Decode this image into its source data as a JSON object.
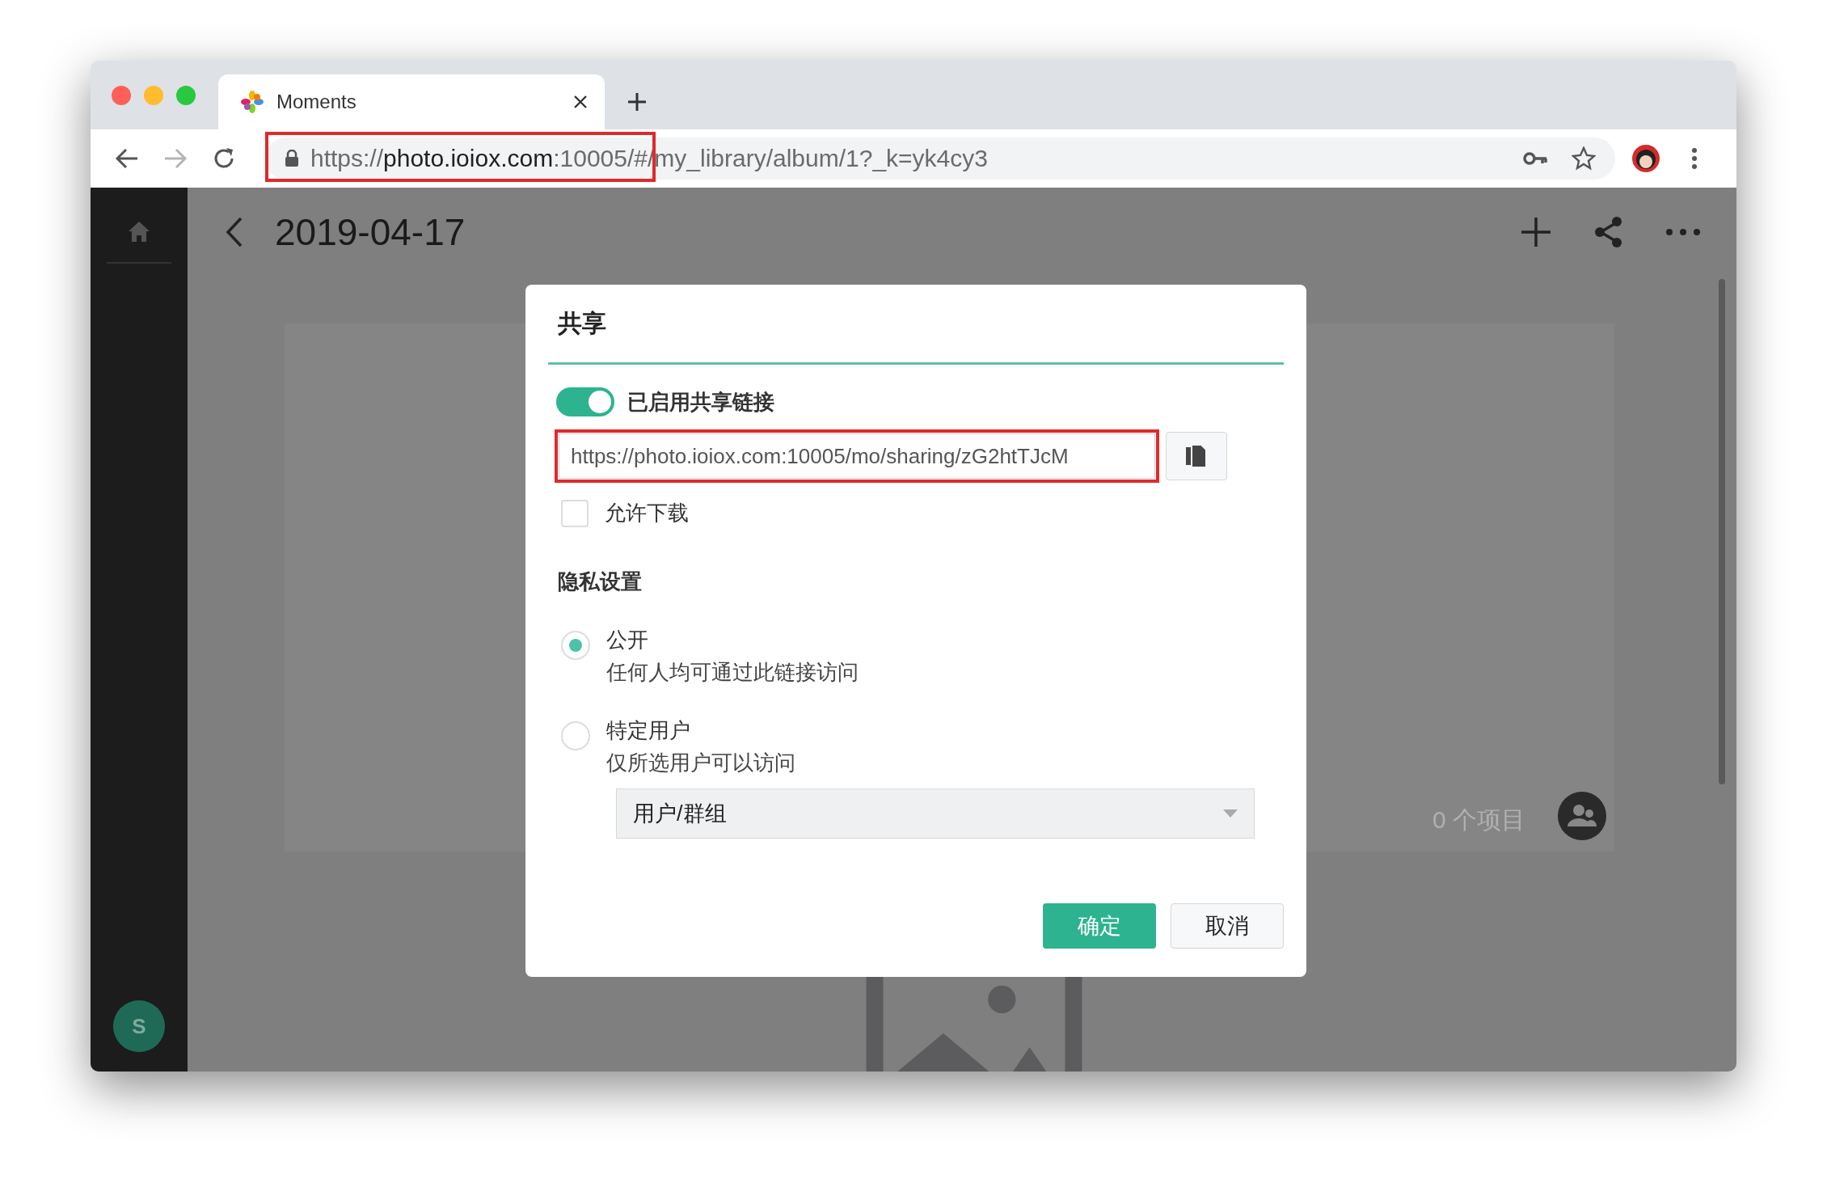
{
  "browser": {
    "tab": {
      "title": "Moments"
    },
    "url": {
      "scheme": "https://",
      "host": "photo.ioiox.com",
      "port": ":10005/",
      "rest": "#/my_library/album/1?_k=yk4cy3"
    }
  },
  "page": {
    "title": "2019-04-17",
    "item_count": "0 个项目",
    "avatar_initial": "S"
  },
  "dialog": {
    "title": "共享",
    "share_link": {
      "on": true,
      "label": "已启用共享链接"
    },
    "link_value": "https://photo.ioiox.com:10005/mo/sharing/zG2htTJcM",
    "allow_download": {
      "checked": false,
      "label": "允许下载"
    },
    "privacy_title": "隐私设置",
    "options": [
      {
        "label": "公开",
        "description": "任何人均可通过此链接访问",
        "selected": true
      },
      {
        "label": "特定用户",
        "description": "仅所选用户可以访问",
        "selected": false
      }
    ],
    "user_select": {
      "value": "用户/群组"
    },
    "buttons": [
      {
        "label": "确定",
        "kind": "primary"
      },
      {
        "label": "取消",
        "kind": "secondary"
      }
    ]
  }
}
